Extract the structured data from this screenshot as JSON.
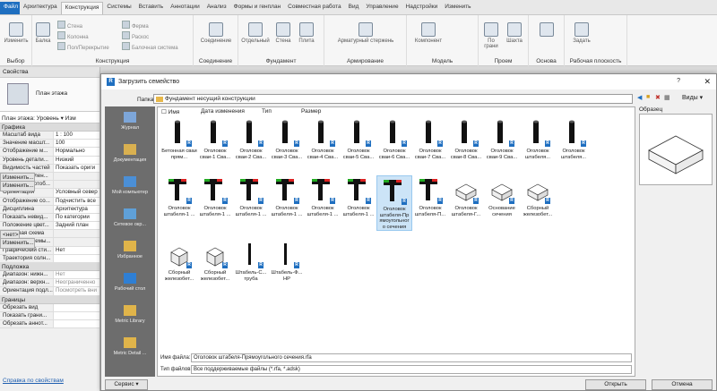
{
  "ribbon_tabs": [
    "Файл",
    "Архитектура",
    "Конструкция",
    "Системы",
    "Вставить",
    "Аннотации",
    "Анализ",
    "Формы и генплан",
    "Совместная работа",
    "Вид",
    "Управление",
    "Надстройки",
    "Изменить"
  ],
  "ribbon_groups": [
    "Выбор",
    "Конструкция",
    "Соединение",
    "Фундамент",
    "Армирование",
    "Модель",
    "Проем",
    "Основа",
    "Рабочая плоскость"
  ],
  "ribbon_buttons": {
    "modify": "Изменить",
    "beam": "Балка",
    "wall": "Стена",
    "column": "Колонна",
    "floor": "Пол/Перекрытие",
    "truss": "Ферма",
    "brace": "Раскос",
    "beam_system": "Балочная система",
    "connection": "Соединение",
    "isolated": "Отдельный",
    "wall_f": "Стена",
    "slab": "Плита",
    "rebar": "Арматурный стержень",
    "component": "Компонент",
    "by_face": "По грани",
    "shaft": "Шахта",
    "set": "Задать"
  },
  "props": {
    "title": "Свойства",
    "preview_label": "План этажа",
    "type_selector": "План этажа: Уровень",
    "edit_type": "Изм",
    "sections": {
      "graphics": "Графика",
      "underlay": "Подложка",
      "extents": "Границы"
    },
    "rows_graphics": [
      {
        "k": "Масштаб вида",
        "v": "1 : 100"
      },
      {
        "k": "Значение масшт...",
        "v": "100"
      },
      {
        "k": "Отображение м...",
        "v": "Нормально"
      },
      {
        "k": "Уровень детали...",
        "v": "Низкий"
      },
      {
        "k": "Видимость частей",
        "v": "Показать ориги"
      },
      {
        "k": "Переопределен...",
        "v": "Изменить...",
        "btn": true
      },
      {
        "k": "Параметры отоб...",
        "v": "Изменить...",
        "btn": true
      },
      {
        "k": "Ориентация",
        "v": "Условный север"
      },
      {
        "k": "Отображение со...",
        "v": "Подчистить все"
      },
      {
        "k": "Дисциплина",
        "v": "Архитектура"
      },
      {
        "k": "Показать невид...",
        "v": "По категории"
      },
      {
        "k": "Положение цвет...",
        "v": "Задний план"
      },
      {
        "k": "Цветовая схема",
        "v": "<нет>",
        "btn": true
      },
      {
        "k": "Цветовые схемы...",
        "v": "Изменить...",
        "btn": true
      },
      {
        "k": "Графический сти...",
        "v": "Нет"
      },
      {
        "k": "Траектория солн...",
        "v": ""
      }
    ],
    "rows_underlay": [
      {
        "k": "Диапазон: нижн...",
        "v": "Нет",
        "gray": true
      },
      {
        "k": "Диапазон: верхн...",
        "v": "Неограниченно",
        "gray": true
      },
      {
        "k": "Ориентация подл...",
        "v": "Посмотреть вни",
        "gray": true
      }
    ],
    "rows_extents": [
      {
        "k": "Обрезать вид",
        "v": ""
      },
      {
        "k": "Показать грани...",
        "v": ""
      },
      {
        "k": "Обрезать аннот...",
        "v": ""
      }
    ],
    "help_link": "Справка по свойствам",
    "apply": "При"
  },
  "dialog": {
    "title": "Загрузить семейство",
    "help": "?",
    "close": "✕",
    "lookin_label": "Папка:",
    "lookin_value": "Фундамент несущий конструкции",
    "views_label": "Виды",
    "preview_label": "Образец",
    "columns": [
      "Имя",
      "Дата изменения",
      "Тип",
      "Размер"
    ],
    "places": [
      "Журнал",
      "Документация",
      "Мой компьютер",
      "Сетевое окр...",
      "Избранное",
      "Рабочий стол",
      "Metric Library",
      "Metric Detail ..."
    ],
    "files": [
      "Бетонная сваи прям...",
      "Оголовок сваи-1 Сва...",
      "Оголовок сваи-2 Сва...",
      "Оголовок сваи-3 Сва...",
      "Оголовок сваи-4 Сва...",
      "Оголовок сваи-5 Сва...",
      "Оголовок сваи-6 Сва...",
      "Оголовок сваи-7 Сва...",
      "Оголовок сваи-8 Сва...",
      "Оголовок сваи-9 Сва...",
      "Оголовок штабеля...",
      "Оголовок штабеля...",
      "Оголовок штабеля-1 ...",
      "Оголовок штабеля-1 ...",
      "Оголовок штабеля-1 ...",
      "Оголовок штабеля-1 ...",
      "Оголовок штабеля-1 ...",
      "Оголовок штабеля-1 ...",
      "Оголовок штабеля-Пр ямоугольног о сечения",
      "Оголовок штабеля-П...",
      "Оголовок штабеля-Г...",
      "Основание сечения",
      "Сборный железобет...",
      "Сборный железобет...",
      "Сборный железобет...",
      "Штабель-С... труба",
      "Штабель-Ф... НР"
    ],
    "selected_index": 18,
    "filename_label": "Имя файла:",
    "filename_value": "Оголовок штабеля-Прямоугольного сечения.rfa",
    "filetype_label": "Тип файлов:",
    "filetype_value": "Все поддерживаемые файлы (*.rfa, *.adsk)",
    "service_button": "Сервис",
    "open_button": "Открыть",
    "cancel_button": "Отмена"
  }
}
